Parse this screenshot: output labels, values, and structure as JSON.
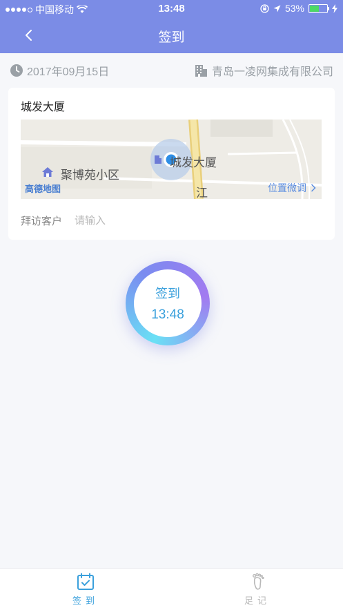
{
  "status_bar": {
    "carrier": "中国移动",
    "time": "13:48",
    "battery": "53%",
    "battery_level": 0.53
  },
  "navbar": {
    "title": "签到"
  },
  "info": {
    "date": "2017年09月15日",
    "company": "青岛一凌网集成有限公司"
  },
  "location_card": {
    "place_name": "城发大厦",
    "map": {
      "poi_left": "聚博苑小区",
      "poi_center": "城发大厦",
      "road": "江",
      "logo": "高德地图",
      "adjust_link": "位置微调"
    },
    "visit_label": "拜访客户",
    "visit_placeholder": "请输入",
    "visit_value": ""
  },
  "checkin_button": {
    "label": "签到",
    "time": "13:48"
  },
  "tabbar": {
    "tabs": [
      {
        "label": "签到",
        "active": true,
        "icon": "calendar-check-icon"
      },
      {
        "label": "足记",
        "active": false,
        "icon": "footprint-icon"
      }
    ]
  },
  "colors": {
    "header": "#7b8ce6",
    "accent": "#3aa0dc",
    "tab_inactive": "#b8b8b8"
  }
}
